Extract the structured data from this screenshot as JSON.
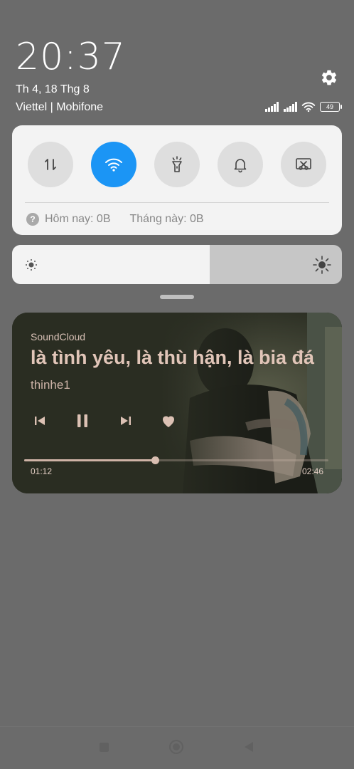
{
  "status": {
    "time": "20:37",
    "date": "Th 4, 18 Thg 8",
    "carrier": "Viettel | Mobifone",
    "battery": "49"
  },
  "quick_settings": {
    "tiles": [
      {
        "icon": "mobile-data-icon",
        "active": false
      },
      {
        "icon": "wifi-icon",
        "active": true
      },
      {
        "icon": "flashlight-icon",
        "active": false
      },
      {
        "icon": "bell-icon",
        "active": false
      },
      {
        "icon": "screenshot-icon",
        "active": false
      }
    ],
    "usage_today": "Hôm nay: 0B",
    "usage_month": "Tháng này: 0B"
  },
  "brightness": {
    "level": 0.6
  },
  "media": {
    "source": "SoundCloud",
    "title": "là tình yêu, là thù hận, là bia đá",
    "artist": "thinhe1",
    "elapsed": "01:12",
    "total": "02:46",
    "progress": 0.43
  },
  "colors": {
    "accent": "#1b95f5",
    "panel": "#f3f3f3",
    "scrim": "#6b6b6b",
    "media_text": "#e1c5b8"
  }
}
